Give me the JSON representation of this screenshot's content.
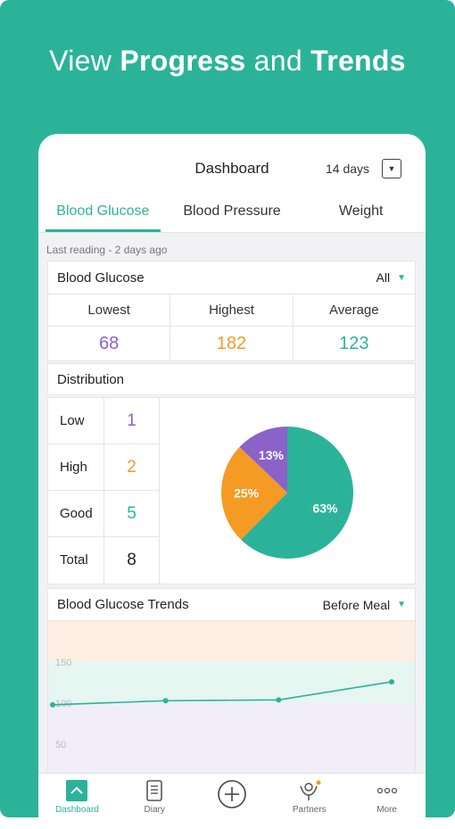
{
  "headline": {
    "prefix": "View ",
    "bold1": "Progress",
    "middle": " and ",
    "bold2": "Trends"
  },
  "nav": {
    "title": "Dashboard",
    "range": "14 days"
  },
  "tabs": [
    {
      "label": "Blood Glucose",
      "active": true
    },
    {
      "label": "Blood Pressure",
      "active": false
    },
    {
      "label": "Weight",
      "active": false
    }
  ],
  "last_reading": "Last reading - 2 days ago",
  "summary": {
    "title": "Blood Glucose",
    "filter": "All",
    "stats": [
      {
        "label": "Lowest",
        "value": "68",
        "color": "#8b62c9"
      },
      {
        "label": "Highest",
        "value": "182",
        "color": "#f59a23"
      },
      {
        "label": "Average",
        "value": "123",
        "color": "#2bb39a"
      }
    ]
  },
  "distribution": {
    "title": "Distribution",
    "rows": [
      {
        "label": "Low",
        "value": "1",
        "color": "#8b62c9"
      },
      {
        "label": "High",
        "value": "2",
        "color": "#f59a23"
      },
      {
        "label": "Good",
        "value": "5",
        "color": "#2bb39a"
      },
      {
        "label": "Total",
        "value": "8",
        "color": "#222222"
      }
    ]
  },
  "trends": {
    "title": "Blood Glucose Trends",
    "filter": "Before Meal"
  },
  "tabbar": [
    {
      "label": "Dashboard",
      "icon": "dashboard-icon",
      "active": true
    },
    {
      "label": "Diary",
      "icon": "diary-icon",
      "active": false
    },
    {
      "label": "",
      "icon": "add-icon",
      "active": false
    },
    {
      "label": "Partners",
      "icon": "partners-icon",
      "active": false
    },
    {
      "label": "More",
      "icon": "more-icon",
      "active": false
    }
  ],
  "colors": {
    "accent": "#2bb39a",
    "low": "#8b62c9",
    "high": "#f59a23",
    "good": "#2bb39a"
  },
  "chart_data": [
    {
      "type": "pie",
      "title": "",
      "slices": [
        {
          "name": "Good",
          "value": 63,
          "label": "63%",
          "color": "#2bb39a"
        },
        {
          "name": "High",
          "value": 25,
          "label": "25%",
          "color": "#f59a23"
        },
        {
          "name": "Low",
          "value": 13,
          "label": "13%",
          "color": "#8b62c9"
        }
      ]
    },
    {
      "type": "line",
      "title": "Blood Glucose Trends",
      "xlabel": "",
      "ylabel": "",
      "ylim": [
        0,
        200
      ],
      "yticks": [
        50,
        100,
        150
      ],
      "grid": false,
      "bands": [
        {
          "from": 150,
          "to": 200,
          "color": "#fdeee4"
        },
        {
          "from": 100,
          "to": 150,
          "color": "#e6f6f1"
        },
        {
          "from": 0,
          "to": 100,
          "color": "#f1eefa"
        }
      ],
      "x": [
        0,
        1,
        2,
        3
      ],
      "series": [
        {
          "values": [
            98,
            103,
            104,
            126
          ],
          "color": "#2bb39a"
        }
      ]
    }
  ]
}
